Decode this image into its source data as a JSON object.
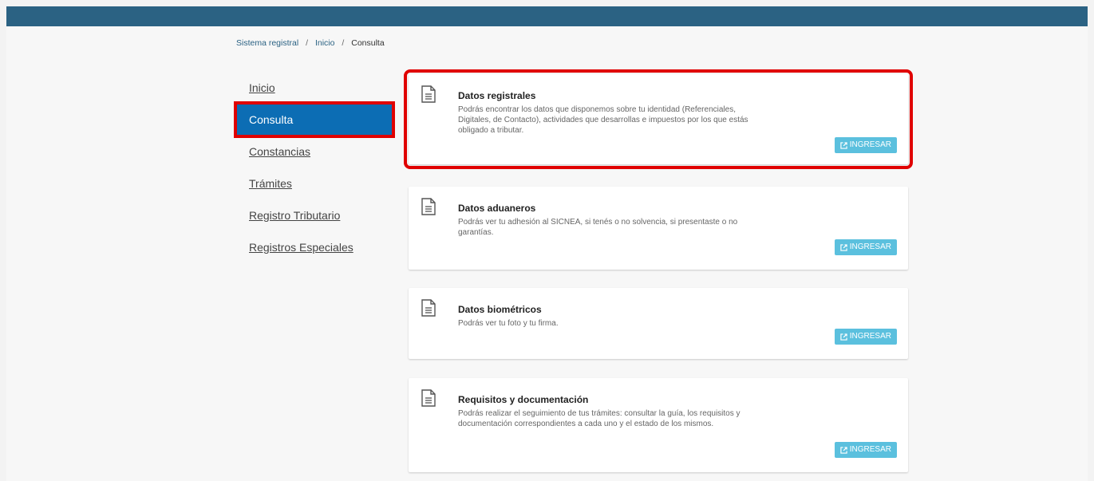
{
  "breadcrumb": {
    "root": "Sistema registral",
    "parent": "Inicio",
    "current": "Consulta",
    "separator": "/"
  },
  "sidebar": {
    "items": [
      {
        "label": "Inicio"
      },
      {
        "label": "Consulta"
      },
      {
        "label": "Constancias"
      },
      {
        "label": "Trámites"
      },
      {
        "label": "Registro Tributario"
      },
      {
        "label": "Registros Especiales"
      }
    ]
  },
  "cards": [
    {
      "title": "Datos registrales",
      "description": "Podrás encontrar los datos que disponemos sobre tu identidad (Referenciales, Digitales, de Contacto), actividades que desarrollas e impuestos por los que estás obligado a tributar.",
      "button": "INGRESAR"
    },
    {
      "title": "Datos aduaneros",
      "description": "Podrás ver tu adhesión al SICNEA, si tenés o no solvencia, si presentaste o no garantías.",
      "button": "INGRESAR"
    },
    {
      "title": "Datos biométricos",
      "description": "Podrás ver tu foto y tu firma.",
      "button": "INGRESAR"
    },
    {
      "title": "Requisitos y documentación",
      "description": "Podrás realizar el seguimiento de tus trámites: consultar la guía, los requisitos y documentación correspondientes a cada uno y el estado de los mismos.",
      "button": "INGRESAR"
    }
  ],
  "colors": {
    "header": "#2b6283",
    "active": "#0c6db4",
    "button": "#5bc0de",
    "highlight": "#e00000"
  }
}
